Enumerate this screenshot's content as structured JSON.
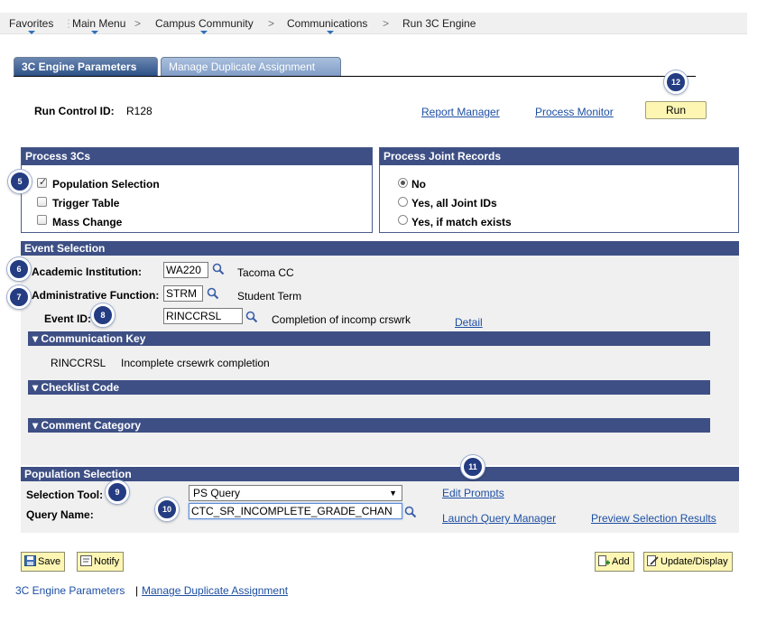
{
  "breadcrumb": {
    "favorites": "Favorites",
    "main_menu": "Main Menu",
    "campus_community": "Campus Community",
    "communications": "Communications",
    "run_3c_engine": "Run 3C Engine",
    "separator": ">"
  },
  "tabs": {
    "params": "3C Engine Parameters",
    "duplicate": "Manage Duplicate Assignment"
  },
  "run_control": {
    "label": "Run Control ID:",
    "value": "R128",
    "report_manager": "Report Manager",
    "process_monitor": "Process Monitor",
    "run_button": "Run"
  },
  "process_3cs": {
    "title": "Process 3Cs",
    "population_selection": "Population Selection",
    "population_selection_checked": true,
    "trigger_table": "Trigger Table",
    "trigger_table_checked": false,
    "mass_change": "Mass Change",
    "mass_change_checked": false
  },
  "joint_records": {
    "title": "Process Joint Records",
    "no": "No",
    "yes_all": "Yes, all Joint IDs",
    "yes_match": "Yes, if match exists",
    "selected": "No"
  },
  "event_selection": {
    "title": "Event Selection",
    "academic_institution_label": "Academic Institution:",
    "academic_institution_value": "WA220",
    "academic_institution_desc": "Tacoma CC",
    "admin_function_label": "Administrative Function:",
    "admin_function_value": "STRM",
    "admin_function_desc": "Student Term",
    "event_id_label": "Event ID:",
    "event_id_value": "RINCCRSL",
    "event_id_desc": "Completion of incomp crswrk",
    "detail_link": "Detail",
    "communication_key_title": "Communication Key",
    "communication_key_code": "RINCCRSL",
    "communication_key_desc": "Incomplete crsewrk completion",
    "checklist_code_title": "Checklist Code",
    "comment_category_title": "Comment Category"
  },
  "population_selection": {
    "title": "Population Selection",
    "selection_tool_label": "Selection Tool:",
    "selection_tool_value": "PS Query",
    "query_name_label": "Query Name:",
    "query_name_value": "CTC_SR_INCOMPLETE_GRADE_CHAN",
    "edit_prompts": "Edit Prompts",
    "launch_query_manager": "Launch Query Manager",
    "preview_selection_results": "Preview Selection Results"
  },
  "toolbar": {
    "save": "Save",
    "notify": "Notify",
    "add": "Add",
    "update_display": "Update/Display"
  },
  "footer": {
    "params_link": "3C Engine Parameters",
    "separator": "|",
    "duplicate_link": "Manage Duplicate Assignment"
  },
  "callouts": {
    "c5": "5",
    "c6": "6",
    "c7": "7",
    "c8": "8",
    "c9": "9",
    "c10": "10",
    "c11": "11",
    "c12": "12"
  },
  "colors": {
    "section_header": "#3d4f84",
    "run_button": "#fdf6b3",
    "link": "#1d4fa3",
    "callout": "#243c82"
  }
}
